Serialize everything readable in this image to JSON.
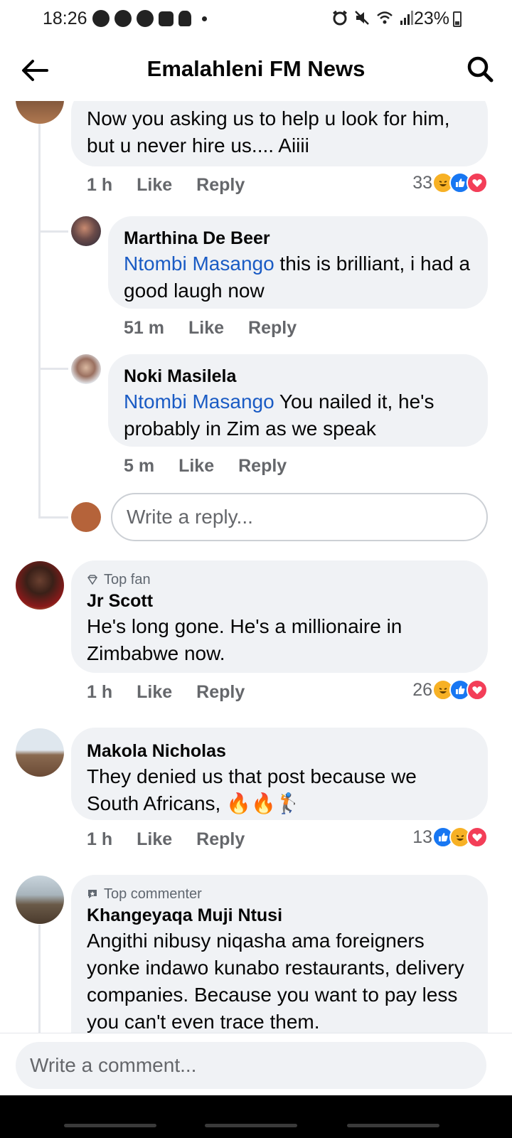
{
  "status_bar": {
    "time": "18:26",
    "battery": "23%"
  },
  "header": {
    "title": "Emalahleni FM News"
  },
  "comments": [
    {
      "text": "Now you asking us to help u look for him, but u never hire us.... Aiiii",
      "time": "1 h",
      "like": "Like",
      "reply": "Reply",
      "reaction_count": "33",
      "reactions": [
        "haha",
        "like",
        "love"
      ],
      "replies": [
        {
          "name": "Marthina De Beer",
          "mention": "Ntombi Masango",
          "text": " this is brilliant, i had a good laugh now",
          "time": "51 m",
          "like": "Like",
          "reply": "Reply"
        },
        {
          "name": "Noki Masilela",
          "mention": "Ntombi Masango",
          "text": " You nailed it, he's probably in Zim as we speak",
          "time": "5 m",
          "like": "Like",
          "reply": "Reply"
        }
      ],
      "reply_placeholder": "Write a reply..."
    },
    {
      "badge": "Top fan",
      "name": "Jr Scott",
      "text": "He's long gone. He's a millionaire in Zimbabwe now.",
      "time": "1 h",
      "like": "Like",
      "reply": "Reply",
      "reaction_count": "26",
      "reactions": [
        "haha",
        "like",
        "love"
      ]
    },
    {
      "name": "Makola Nicholas",
      "text": "They denied us that post because we South Africans, 🔥🔥🏌",
      "time": "1 h",
      "like": "Like",
      "reply": "Reply",
      "reaction_count": "13",
      "reactions": [
        "like",
        "haha",
        "love"
      ]
    },
    {
      "badge": "Top commenter",
      "name": "Khangeyaqa Muji Ntusi",
      "text": "Angithi nibusy niqasha ama foreigners yonke indawo kunabo restaurants, delivery companies. Because you want to pay less you  can't even trace them."
    }
  ],
  "comment_bar": {
    "placeholder": "Write a comment..."
  },
  "colors": {
    "bubble": "#f0f2f5",
    "mention": "#1a5bc4",
    "like": "#1877f2",
    "love": "#f33e58",
    "haha": "#f7b125"
  }
}
